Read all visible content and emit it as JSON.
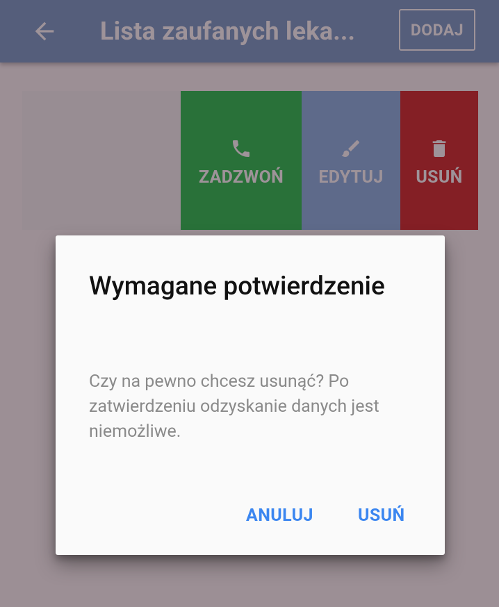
{
  "appbar": {
    "back_icon": "arrow-back-icon",
    "title": "Lista zaufanych leka...",
    "add_label": "DODAJ",
    "color": "#7a9fc9"
  },
  "swipe_actions": {
    "call": {
      "label": "ZADZWOŃ",
      "icon": "phone-icon",
      "color": "#2bc150"
    },
    "edit": {
      "label": "EDYTUJ",
      "icon": "brush-icon",
      "color": "#8bb5e4"
    },
    "delete": {
      "label": "USUŃ",
      "icon": "trash-icon",
      "color": "#cf2c2c"
    }
  },
  "dialog": {
    "title": "Wymagane potwierdzenie",
    "message": "Czy na pewno chcesz usunąć? Po zatwierdzeniu odzyskanie danych jest niemożliwe.",
    "cancel_label": "ANULUJ",
    "confirm_label": "USUŃ",
    "button_color": "#3b86f0"
  }
}
